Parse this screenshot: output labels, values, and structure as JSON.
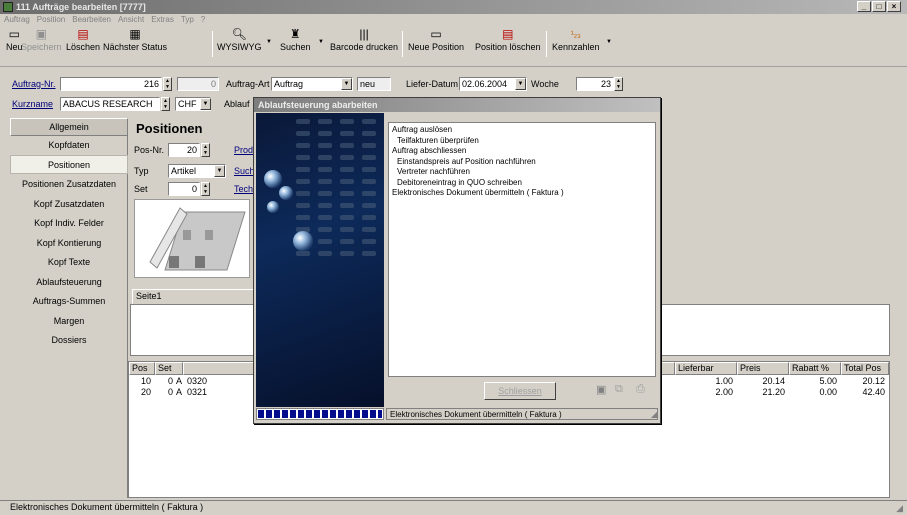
{
  "window": {
    "title": "111 Aufträge bearbeiten [7777]"
  },
  "menu": [
    "Auftrag",
    "Position",
    "Bearbeiten",
    "Ansicht",
    "Extras",
    "Typ",
    "?"
  ],
  "toolbar": {
    "neu": "Neu",
    "speichern": "Speichern",
    "loeschen": "Löschen",
    "naechster_status": "Nächster Status",
    "wysiwyg": "WYSIWYG",
    "suchen": "Suchen",
    "barcode": "Barcode drucken",
    "neue_position": "Neue Position",
    "position_loeschen": "Position löschen",
    "kennzahlen": "Kennzahlen"
  },
  "header": {
    "auftrag_nr_label": "Auftrag-Nr.",
    "auftrag_nr": "216",
    "auftrag_sub": "0",
    "auftrag_art_label": "Auftrag-Art",
    "auftrag_art": "Auftrag",
    "neu_label": "neu",
    "liefer_datum_label": "Liefer-Datum",
    "liefer_datum": "02.06.2004",
    "woche_label": "Woche",
    "woche": "23",
    "kurzname_label": "Kurzname",
    "kurzname": "ABACUS RESEARCH",
    "waehrung": "CHF",
    "ablauf_label": "Ablauf"
  },
  "nav": {
    "items": [
      "Allgemein",
      "Kopfdaten",
      "Positionen",
      "Positionen Zusatzdaten",
      "Kopf Zusatzdaten",
      "Kopf Indiv. Felder",
      "Kopf Kontierung",
      "Kopf Texte",
      "Ablaufsteuerung",
      "Auftrags-Summen",
      "Margen",
      "Dossiers"
    ]
  },
  "positionen": {
    "title": "Positionen",
    "pos_nr_label": "Pos-Nr.",
    "pos_nr": "20",
    "typ_label": "Typ",
    "typ": "Artikel",
    "set_label": "Set",
    "set": "0",
    "prod_link": "Prod",
    "such_link": "Such",
    "tech_link": "Tech",
    "tab": "Seite1"
  },
  "grid": {
    "headers": [
      "Pos",
      "Set",
      "Pr",
      "Lieferbar",
      "Preis",
      "Rabatt %",
      "Total Pos"
    ],
    "rows": [
      {
        "pos": "10",
        "set": "0",
        "flag": "A",
        "prod": "0320",
        "lieferbar": "1.00",
        "preis": "20.14",
        "rabatt": "5.00",
        "total": "20.12"
      },
      {
        "pos": "20",
        "set": "0",
        "flag": "A",
        "prod": "0321",
        "lieferbar": "2.00",
        "preis": "21.20",
        "rabatt": "0.00",
        "total": "42.40"
      }
    ]
  },
  "dialog": {
    "title": "Ablaufsteuerung abarbeiten",
    "items": [
      "Auftrag auslösen",
      "Teilfakturen überprüfen",
      "Auftrag abschliessen",
      "Einstandspreis auf Position nachführen",
      "Vertreter nachführen",
      "Debitoreneintrag in QUO schreiben",
      "Elektronisches Dokument übermitteln ( Faktura )"
    ],
    "schliessen": "Schliessen",
    "status": "Elektronisches Dokument übermitteln ( Faktura )",
    "progress_fraction": 1.0
  },
  "statusbar": {
    "text": "Elektronisches Dokument übermitteln ( Faktura )"
  }
}
